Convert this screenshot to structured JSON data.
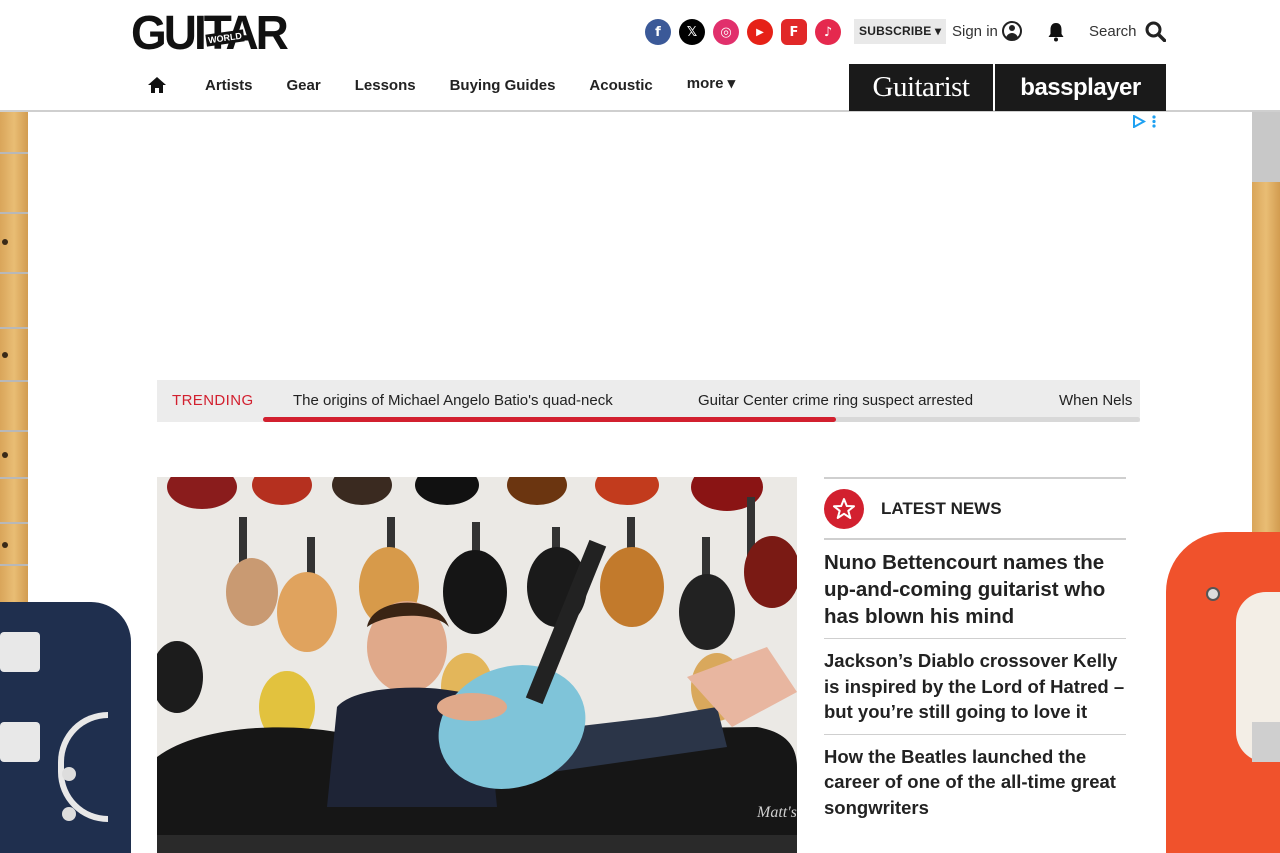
{
  "header": {
    "logo_main": "GUITAR",
    "logo_sub": "WORLD",
    "social": [
      {
        "icon": "facebook-icon",
        "glyph": "f",
        "color": "#3b5998"
      },
      {
        "icon": "x-icon",
        "glyph": "𝕏",
        "color": "#000000"
      },
      {
        "icon": "instagram-icon",
        "glyph": "◎",
        "color": "#e1306c"
      },
      {
        "icon": "youtube-icon",
        "glyph": "▶",
        "color": "#e62117"
      },
      {
        "icon": "flipboard-icon",
        "glyph": "F",
        "color": "#e12828"
      },
      {
        "icon": "tiktok-icon",
        "glyph": "♪",
        "color": "#e5294e"
      }
    ],
    "subscribe_label": "SUBSCRIBE ▾",
    "sign_in_label": "Sign in",
    "search_label": "Search"
  },
  "nav": {
    "items": [
      "Artists",
      "Gear",
      "Lessons",
      "Buying Guides",
      "Acoustic"
    ],
    "more_label": "more ▾"
  },
  "sister_sites": {
    "guitarist": "Guitarist",
    "bassplayer": "bassplayer"
  },
  "trending": {
    "label": "TRENDING",
    "items": [
      "The origins of Michael Angelo Batio's quad-neck",
      "Guitar Center crime ring suspect arrested",
      "When Nels"
    ]
  },
  "latest_news": {
    "title": "LATEST NEWS",
    "stories": [
      "Nuno Bettencourt names the up-and-coming guitarist who has blown his mind",
      "Jackson’s Diablo crossover Kelly is inspired by the Lord of Hatred – but you’re still going to love it",
      "How the Beatles launched the career of one of the all-time great songwriters"
    ]
  },
  "hero": {
    "watermark": "Matt's"
  },
  "colors": {
    "accent": "#d2202f",
    "trending_bg": "#ececec",
    "sister_bg": "#1a1a1a"
  }
}
